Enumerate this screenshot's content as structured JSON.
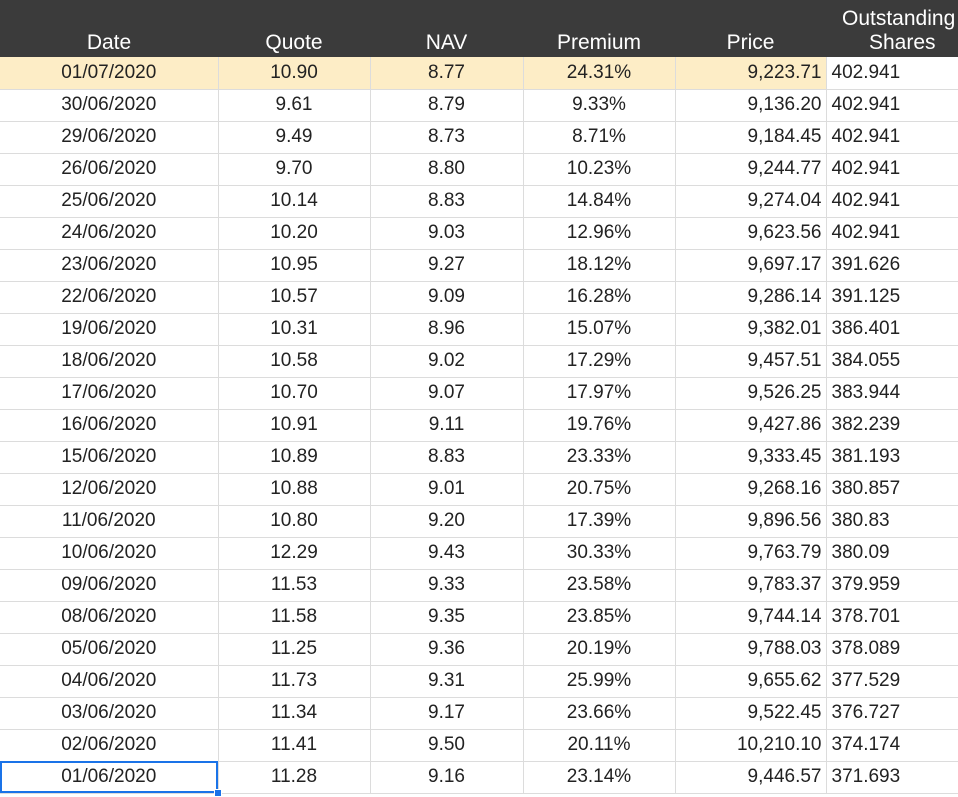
{
  "headers": {
    "date": "Date",
    "quote": "Quote",
    "nav": "NAV",
    "premium": "Premium",
    "price": "Price",
    "shares_line1": "Outstanding",
    "shares_line2": "Shares"
  },
  "rows": [
    {
      "date": "01/07/2020",
      "quote": "10.90",
      "nav": "8.77",
      "premium": "24.31%",
      "price": "9,223.71",
      "shares": "402.941"
    },
    {
      "date": "30/06/2020",
      "quote": "9.61",
      "nav": "8.79",
      "premium": "9.33%",
      "price": "9,136.20",
      "shares": "402.941"
    },
    {
      "date": "29/06/2020",
      "quote": "9.49",
      "nav": "8.73",
      "premium": "8.71%",
      "price": "9,184.45",
      "shares": "402.941"
    },
    {
      "date": "26/06/2020",
      "quote": "9.70",
      "nav": "8.80",
      "premium": "10.23%",
      "price": "9,244.77",
      "shares": "402.941"
    },
    {
      "date": "25/06/2020",
      "quote": "10.14",
      "nav": "8.83",
      "premium": "14.84%",
      "price": "9,274.04",
      "shares": "402.941"
    },
    {
      "date": "24/06/2020",
      "quote": "10.20",
      "nav": "9.03",
      "premium": "12.96%",
      "price": "9,623.56",
      "shares": "402.941"
    },
    {
      "date": "23/06/2020",
      "quote": "10.95",
      "nav": "9.27",
      "premium": "18.12%",
      "price": "9,697.17",
      "shares": "391.626"
    },
    {
      "date": "22/06/2020",
      "quote": "10.57",
      "nav": "9.09",
      "premium": "16.28%",
      "price": "9,286.14",
      "shares": "391.125"
    },
    {
      "date": "19/06/2020",
      "quote": "10.31",
      "nav": "8.96",
      "premium": "15.07%",
      "price": "9,382.01",
      "shares": "386.401"
    },
    {
      "date": "18/06/2020",
      "quote": "10.58",
      "nav": "9.02",
      "premium": "17.29%",
      "price": "9,457.51",
      "shares": "384.055"
    },
    {
      "date": "17/06/2020",
      "quote": "10.70",
      "nav": "9.07",
      "premium": "17.97%",
      "price": "9,526.25",
      "shares": "383.944"
    },
    {
      "date": "16/06/2020",
      "quote": "10.91",
      "nav": "9.11",
      "premium": "19.76%",
      "price": "9,427.86",
      "shares": "382.239"
    },
    {
      "date": "15/06/2020",
      "quote": "10.89",
      "nav": "8.83",
      "premium": "23.33%",
      "price": "9,333.45",
      "shares": "381.193"
    },
    {
      "date": "12/06/2020",
      "quote": "10.88",
      "nav": "9.01",
      "premium": "20.75%",
      "price": "9,268.16",
      "shares": "380.857"
    },
    {
      "date": "11/06/2020",
      "quote": "10.80",
      "nav": "9.20",
      "premium": "17.39%",
      "price": "9,896.56",
      "shares": "380.83"
    },
    {
      "date": "10/06/2020",
      "quote": "12.29",
      "nav": "9.43",
      "premium": "30.33%",
      "price": "9,763.79",
      "shares": "380.09"
    },
    {
      "date": "09/06/2020",
      "quote": "11.53",
      "nav": "9.33",
      "premium": "23.58%",
      "price": "9,783.37",
      "shares": "379.959"
    },
    {
      "date": "08/06/2020",
      "quote": "11.58",
      "nav": "9.35",
      "premium": "23.85%",
      "price": "9,744.14",
      "shares": "378.701"
    },
    {
      "date": "05/06/2020",
      "quote": "11.25",
      "nav": "9.36",
      "premium": "20.19%",
      "price": "9,788.03",
      "shares": "378.089"
    },
    {
      "date": "04/06/2020",
      "quote": "11.73",
      "nav": "9.31",
      "premium": "25.99%",
      "price": "9,655.62",
      "shares": "377.529"
    },
    {
      "date": "03/06/2020",
      "quote": "11.34",
      "nav": "9.17",
      "premium": "23.66%",
      "price": "9,522.45",
      "shares": "376.727"
    },
    {
      "date": "02/06/2020",
      "quote": "11.41",
      "nav": "9.50",
      "premium": "20.11%",
      "price": "10,210.10",
      "shares": "374.174"
    },
    {
      "date": "01/06/2020",
      "quote": "11.28",
      "nav": "9.16",
      "premium": "23.14%",
      "price": "9,446.57",
      "shares": "371.693"
    }
  ],
  "colors": {
    "header_bg": "#3b3b3b",
    "highlight_row": "#fdedc6",
    "selection": "#1a73e8"
  }
}
